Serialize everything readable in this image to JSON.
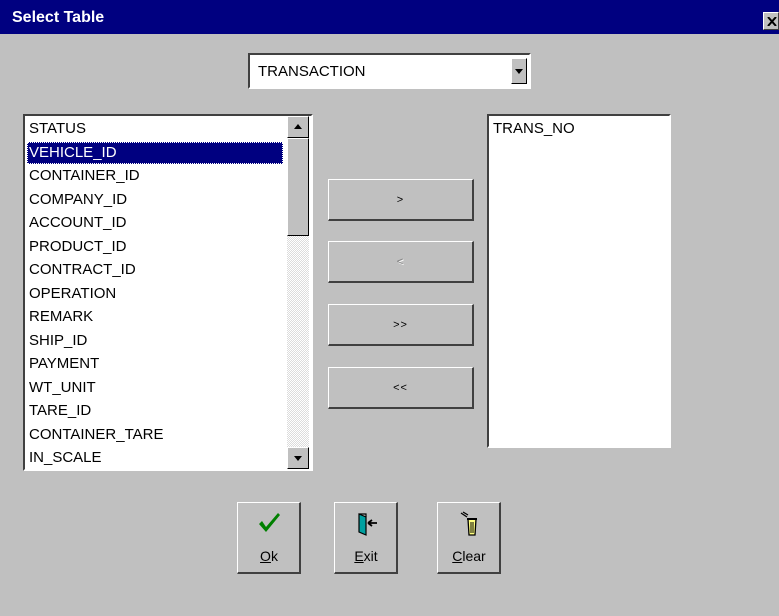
{
  "window": {
    "title": "Select Table",
    "close_glyph": "✕"
  },
  "table_select": {
    "value": "TRANSACTION"
  },
  "available_fields": [
    "STATUS",
    "VEHICLE_ID",
    "CONTAINER_ID",
    "COMPANY_ID",
    "ACCOUNT_ID",
    "PRODUCT_ID",
    "CONTRACT_ID",
    "OPERATION",
    "REMARK",
    "SHIP_ID",
    "PAYMENT",
    "WT_UNIT",
    "TARE_ID",
    "CONTAINER_TARE",
    "IN_SCALE"
  ],
  "selected_available_index": 1,
  "selected_fields": [
    "TRANS_NO"
  ],
  "transfer_buttons": {
    "add": ">",
    "remove": "<",
    "add_all": ">>",
    "remove_all": "<<"
  },
  "actions": {
    "ok": {
      "mnemonic": "O",
      "rest": "k",
      "icon": "checkmark-icon"
    },
    "exit": {
      "mnemonic": "E",
      "rest": "xit",
      "icon": "exit-door-icon"
    },
    "clear": {
      "mnemonic": "C",
      "rest": "lear",
      "icon": "trash-can-icon"
    }
  },
  "colors": {
    "face": "#c0c0c0",
    "titlebar": "#000080",
    "selection": "#000080",
    "check": "#008000"
  }
}
